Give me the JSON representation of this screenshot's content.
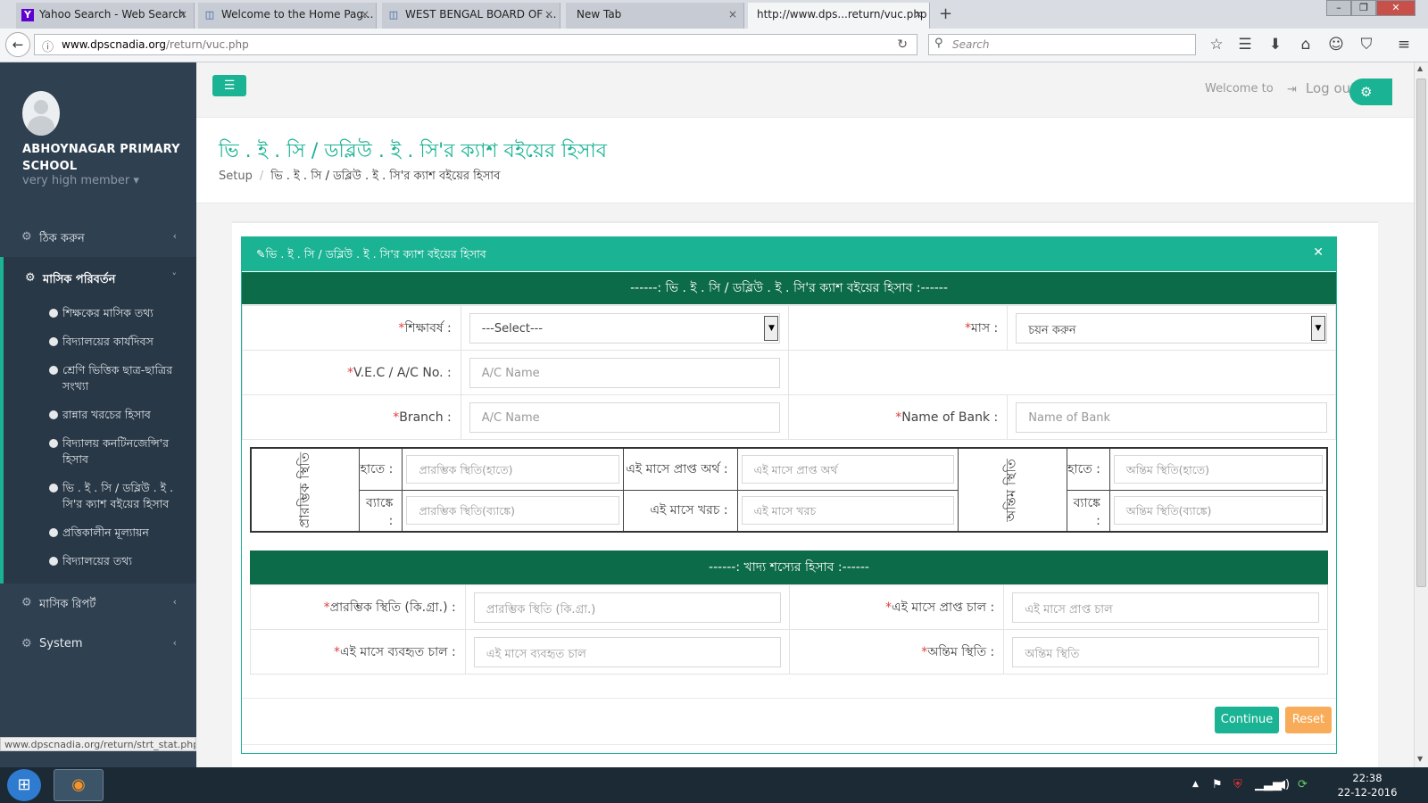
{
  "browser": {
    "tabs": [
      {
        "label": "Yahoo Search - Web Search",
        "icon": "Y"
      },
      {
        "label": "Welcome to the Home Pag...",
        "icon": "◫"
      },
      {
        "label": "WEST BENGAL BOARD OF ...",
        "icon": "◫"
      },
      {
        "label": "New Tab",
        "icon": ""
      },
      {
        "label": "http://www.dps...return/vuc.php",
        "icon": ""
      }
    ],
    "close_glyph": "×",
    "new_tab_glyph": "+",
    "window_controls": {
      "minimize": "–",
      "restore": "❐",
      "close": "✕"
    },
    "url_host": "www.dpscnadia.org",
    "url_path": "/return/vuc.php",
    "search_placeholder": "Search",
    "status_url": "www.dpscnadia.org/return/strt_stat.php"
  },
  "user": {
    "school": "ABHOYNAGAR PRIMARY SCHOOL",
    "role": "very high member ▾"
  },
  "sidebar": {
    "items": [
      {
        "label": "ঠিক করুন",
        "arrow": "‹"
      },
      {
        "label": "মাসিক পরিবর্তন",
        "arrow": "˅"
      },
      {
        "label": "মাসিক রিপর্ট",
        "arrow": "‹"
      },
      {
        "label": "System",
        "arrow": "‹"
      }
    ],
    "subitems": [
      "শিক্ষকের মাসিক তথ্য",
      "বিদ্যালয়ের কার্যদিবস",
      "শ্রেণি ভিত্তিক ছাত্র-ছাত্রির সংখ্যা",
      "রান্নার খরচের হিসাব",
      "বিদ্যালয় কনটিনজেন্সি'র হিসাব",
      "ভি . ই . সি / ডব্লিউ . ই . সি'র ক্যাশ বইয়ের হিসাব",
      "প্রত্তিকালীন মূল্যায়ন",
      "বিদ্যালয়ের তথ্য"
    ]
  },
  "topbar": {
    "welcome": "Welcome to",
    "logout": "Log out"
  },
  "page": {
    "title": "ভি . ই . সি / ডব্লিউ . ই . সি'র ক্যাশ বইয়ের হিসাব",
    "breadcrumb": [
      "Setup",
      "ভি . ই . সি / ডব্লিউ . ই . সি'র ক্যাশ বইয়ের হিসাব"
    ]
  },
  "panel": {
    "title": "ভি . ই . সি / ডব্লিউ . ই . সি'র ক্যাশ বইয়ের হিসাব",
    "section1": "------:  ভি . ই . সি / ডব্লিউ . ই . সি'র ক্যাশ বইয়ের হিসাব  :------",
    "section2": "------:  খাদ্য শস্যের হিসাব  :------"
  },
  "form": {
    "year_label": "শিক্ষাবর্ষ :",
    "year_value": "---Select---",
    "month_label": "মাস :",
    "month_value": "চয়ন করুন",
    "vec_label": "V.E.C / A/C No. :",
    "vec_placeholder": "A/C Name",
    "branch_label": "Branch :",
    "branch_placeholder": "A/C Name",
    "bank_label": "Name of Bank :",
    "bank_placeholder": "Name of Bank"
  },
  "balance": {
    "opening": "প্রারম্ভিক স্থিতি",
    "closing": "অন্তিম স্থিতি",
    "hand_label": "হাতে :",
    "bank_label": "ব্যাঙ্কে :",
    "opening_hand_ph": "প্রারম্ভিক স্থিতি(হাতে)",
    "opening_bank_ph": "প্রারম্ভিক স্থিতি(ব্যাঙ্কে)",
    "received_label": "এই মাসে প্রাপ্ত অর্থ :",
    "received_ph": "এই মাসে প্রাপ্ত অর্থ",
    "spent_label": "এই মাসে খরচ :",
    "spent_ph": "এই মাসে খরচ",
    "closing_hand_ph": "অন্তিম স্থিতি(হাতে)",
    "closing_bank_ph": "অন্তিম স্থিতি(ব্যাঙ্কে)"
  },
  "grain": {
    "opening_label": "প্রারম্ভিক স্থিতি (কি.গ্রা.) :",
    "opening_ph": "প্রারম্ভিক স্থিতি (কি.গ্রা.)",
    "received_label": "এই মাসে প্রাপ্ত চাল :",
    "received_ph": "এই মাসে প্রাপ্ত চাল",
    "used_label": "এই মাসে ব্যবহৃত চাল :",
    "used_ph": "এই মাসে ব্যবহৃত চাল",
    "closing_label": "অন্তিম স্থিতি :",
    "closing_ph": "অন্তিম স্থিতি"
  },
  "buttons": {
    "continue": "Continue",
    "reset": "Reset"
  },
  "taskbar": {
    "time": "22:38",
    "date": "22-12-2016"
  },
  "icons": {
    "nav_item": "gear-icon",
    "logout": "sign-out-icon",
    "panel_title": "edit-icon",
    "close": "close-icon"
  },
  "colors": {
    "accent": "#1ab394",
    "section": "#0c6b49",
    "sidebar": "#2f4050",
    "reset": "#f8ac59",
    "required": "#e03e3e"
  }
}
